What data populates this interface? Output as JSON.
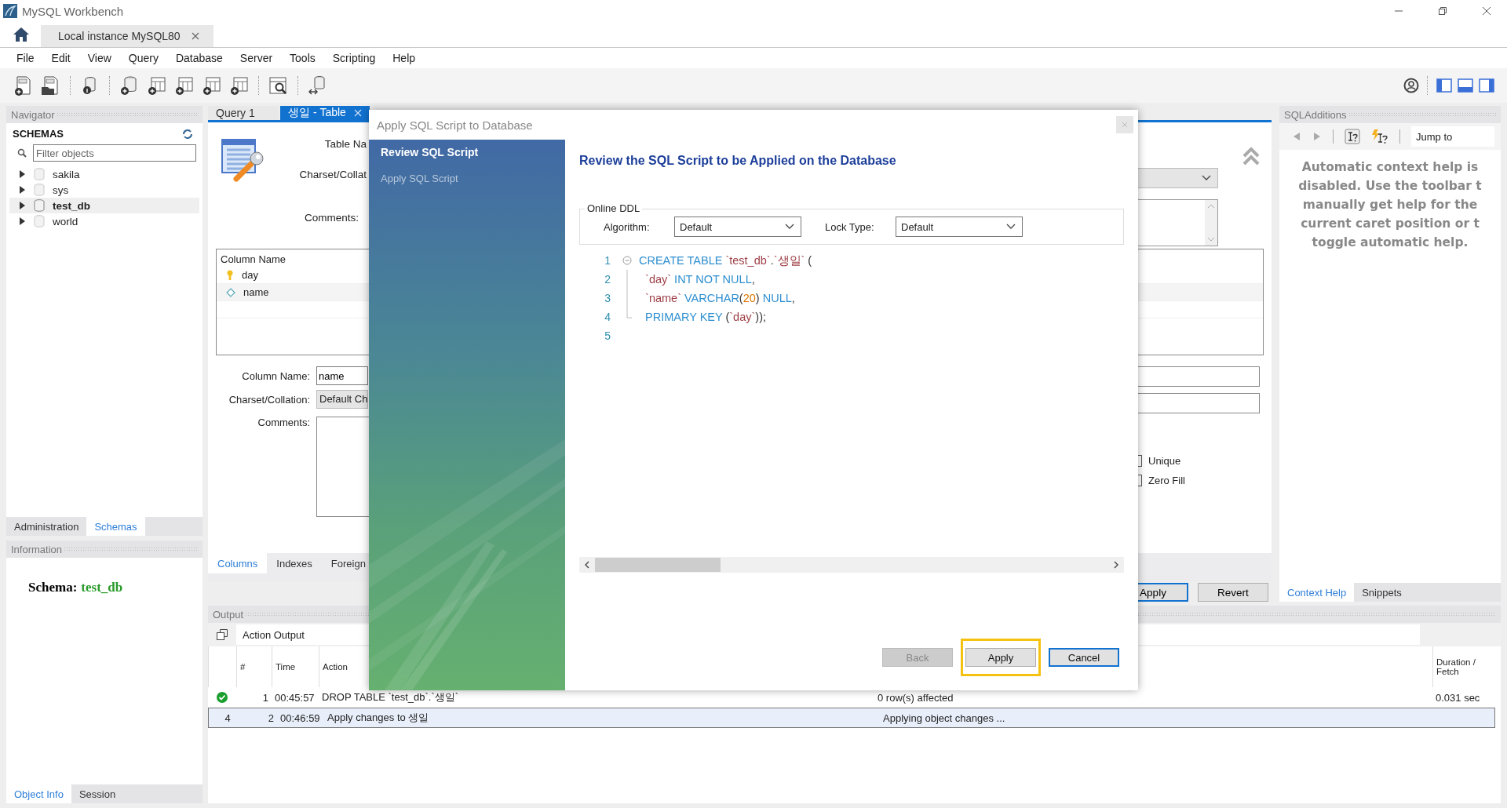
{
  "window": {
    "title": "MySQL Workbench"
  },
  "connection_tabs": [
    {
      "label": "Local instance MySQL80"
    }
  ],
  "menu": [
    "File",
    "Edit",
    "View",
    "Query",
    "Database",
    "Server",
    "Tools",
    "Scripting",
    "Help"
  ],
  "navigator": {
    "title": "Navigator",
    "section": "SCHEMAS",
    "filter_placeholder": "Filter objects",
    "schemas": [
      {
        "name": "sakila",
        "selected": false
      },
      {
        "name": "sys",
        "selected": false
      },
      {
        "name": "test_db",
        "selected": true
      },
      {
        "name": "world",
        "selected": false
      }
    ],
    "tabs": [
      {
        "label": "Administration",
        "selected": false
      },
      {
        "label": "Schemas",
        "selected": true
      }
    ]
  },
  "information": {
    "title": "Information",
    "label": "Schema:",
    "value": "test_db",
    "tabs": [
      {
        "label": "Object Info",
        "selected": true
      },
      {
        "label": "Session",
        "selected": false
      }
    ]
  },
  "editor_tabs": [
    {
      "label": "Query 1",
      "selected": false,
      "closable": false
    },
    {
      "label": "생일 - Table",
      "selected": true,
      "closable": true
    }
  ],
  "table_editor": {
    "table_name_label": "Table Na",
    "charset_label": "Charset/Collat",
    "comments_label": "Comments:",
    "column_list": {
      "header": "Column Name",
      "columns": [
        {
          "name": "day",
          "kind": "primary_key",
          "selected": false
        },
        {
          "name": "name",
          "kind": "column",
          "selected": true
        }
      ]
    },
    "column_name_label": "Column Name:",
    "column_name_value": "name",
    "column_charset_label": "Charset/Collation:",
    "column_charset_value": "Default Ch",
    "column_comments_label": "Comments:",
    "flags": [
      {
        "label": "Unique",
        "checked": false
      },
      {
        "label": "Zero Fill",
        "checked": false
      }
    ],
    "tabs": [
      {
        "label": "Columns",
        "selected": true
      },
      {
        "label": "Indexes",
        "selected": false
      },
      {
        "label": "Foreign",
        "selected": false
      }
    ],
    "buttons": [
      {
        "label": "Apply",
        "focused": true
      },
      {
        "label": "Revert",
        "focused": false
      }
    ]
  },
  "sql_additions": {
    "title": "SQLAdditions",
    "jump_to": "Jump to",
    "help_lines": [
      "Automatic context help is",
      "disabled. Use the toolbar t",
      "manually get help for the",
      "current caret position or t",
      "toggle automatic help."
    ],
    "tabs": [
      {
        "label": "Context Help",
        "selected": true
      },
      {
        "label": "Snippets",
        "selected": false
      }
    ]
  },
  "output": {
    "title": "Output",
    "mode": "Action Output",
    "header": {
      "number": "#",
      "time": "Time",
      "action": "Action",
      "duration": "Duration / Fetch"
    },
    "rows": [
      {
        "kind": "ok",
        "number": "1",
        "time": "00:45:57",
        "action": "DROP TABLE `test_db`.`생일`",
        "message": "0 row(s) affected",
        "duration": "0.031 sec",
        "selected": false
      },
      {
        "kind": "busy",
        "status_text": "4",
        "number": "2",
        "time": "00:46:59",
        "action": "Apply changes to 생일",
        "message": "Applying object changes ...",
        "selected": true
      }
    ]
  },
  "dialog": {
    "title": "Apply SQL Script to Database",
    "steps": [
      {
        "label": "Review SQL Script",
        "selected": true
      },
      {
        "label": "Apply SQL Script",
        "selected": false
      }
    ],
    "heading": "Review the SQL Script to be Applied on the Database",
    "online_ddl": {
      "legend": "Online DDL",
      "algorithm_label": "Algorithm:",
      "algorithm": "Default",
      "lock_label": "Lock Type:",
      "lock": "Default"
    },
    "script": [
      {
        "number": "1",
        "kind": "fold_start",
        "tokens": [
          {
            "kind": "keyword",
            "text": "CREATE TABLE "
          },
          {
            "kind": "identifier",
            "text": "`test_db`"
          },
          {
            "kind": "punct",
            "text": "."
          },
          {
            "kind": "identifier",
            "text": "`생일`"
          },
          {
            "kind": "punct",
            "text": " ("
          }
        ]
      },
      {
        "number": "2",
        "kind": "fold_body",
        "tokens": [
          {
            "kind": "identifier",
            "text": "  `day`"
          },
          {
            "kind": "keyword",
            "text": " INT NOT NULL"
          },
          {
            "kind": "punct",
            "text": ","
          }
        ]
      },
      {
        "number": "3",
        "kind": "fold_body",
        "tokens": [
          {
            "kind": "identifier",
            "text": "  `name`"
          },
          {
            "kind": "keyword",
            "text": " VARCHAR"
          },
          {
            "kind": "punct",
            "text": "("
          },
          {
            "kind": "number",
            "text": "20"
          },
          {
            "kind": "punct",
            "text": ")"
          },
          {
            "kind": "keyword",
            "text": " NULL"
          },
          {
            "kind": "punct",
            "text": ","
          }
        ]
      },
      {
        "number": "4",
        "kind": "fold_end",
        "tokens": [
          {
            "kind": "keyword",
            "text": "  PRIMARY KEY "
          },
          {
            "kind": "punct",
            "text": "("
          },
          {
            "kind": "identifier",
            "text": "`day`"
          },
          {
            "kind": "punct",
            "text": "));"
          }
        ]
      },
      {
        "number": "5",
        "kind": "plain"
      }
    ],
    "buttons": [
      {
        "label": "Back",
        "disabled": true,
        "focused": false,
        "highlighted": false
      },
      {
        "label": "Apply",
        "disabled": false,
        "focused": false,
        "highlighted": true
      },
      {
        "label": "Cancel",
        "disabled": false,
        "focused": true,
        "highlighted": false
      }
    ]
  }
}
